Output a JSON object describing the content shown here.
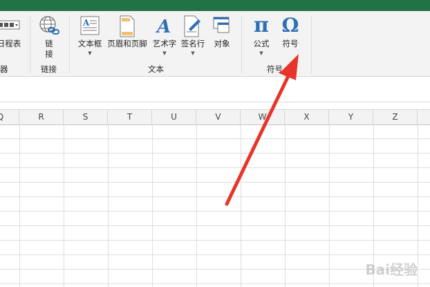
{
  "ribbon": {
    "partial_left_button": "日程表",
    "partial_left_group": "器",
    "link_group": {
      "button_top": "链",
      "button_bottom": "接",
      "group_label": "链接"
    },
    "text_group": {
      "group_label": "文本",
      "buttons": [
        {
          "label": "文本框",
          "icon": "textbox-icon"
        },
        {
          "label": "页眉和页脚",
          "icon": "header-footer-icon"
        },
        {
          "label": "艺术字",
          "icon": "wordart-icon"
        },
        {
          "label": "签名行",
          "icon": "signature-line-icon"
        },
        {
          "label": "对象",
          "icon": "object-icon"
        }
      ]
    },
    "symbol_group": {
      "group_label": "符号",
      "equation": {
        "label": "公式",
        "glyph": "π"
      },
      "symbol": {
        "label": "符号",
        "glyph": "Ω"
      }
    }
  },
  "columns": [
    "Q",
    "R",
    "S",
    "T",
    "U",
    "V",
    "W",
    "X",
    "Y",
    "Z"
  ],
  "watermark": "Bai经验",
  "colors": {
    "excel_green": "#217346",
    "icon_blue": "#2f6fb6",
    "arrow_red": "#e8352b"
  }
}
